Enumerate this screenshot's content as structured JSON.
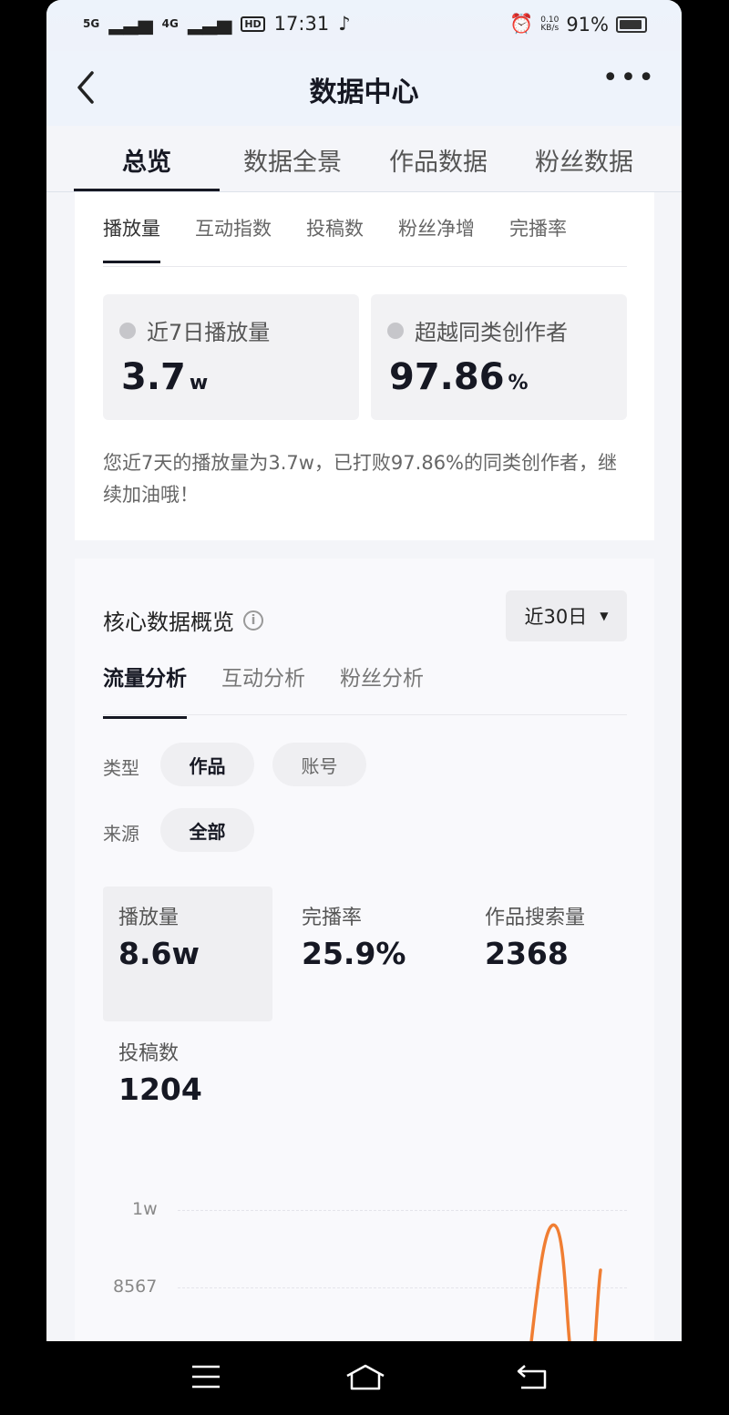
{
  "status_bar": {
    "network1": "5G",
    "network2": "4G",
    "hd": "HD",
    "time": "17:31",
    "net_speed_value": "0.10",
    "net_speed_unit": "KB/s",
    "battery": "91%"
  },
  "header": {
    "title": "数据中心"
  },
  "main_tabs": [
    {
      "label": "总览",
      "active": true
    },
    {
      "label": "数据全景",
      "active": false
    },
    {
      "label": "作品数据",
      "active": false
    },
    {
      "label": "粉丝数据",
      "active": false
    }
  ],
  "overview": {
    "subtabs": [
      {
        "label": "播放量",
        "active": true
      },
      {
        "label": "互动指数",
        "active": false
      },
      {
        "label": "投稿数",
        "active": false
      },
      {
        "label": "粉丝净增",
        "active": false
      },
      {
        "label": "完播率",
        "active": false
      }
    ],
    "stat1": {
      "label": "近7日播放量",
      "value": "3.7",
      "unit": "w"
    },
    "stat2": {
      "label": "超越同类创作者",
      "value": "97.86",
      "unit": "%"
    },
    "description": "您近7天的播放量为3.7w，已打败97.86%的同类创作者，继续加油哦！"
  },
  "core": {
    "title": "核心数据概览",
    "range": "近30日",
    "analysis_tabs": [
      {
        "label": "流量分析",
        "active": true
      },
      {
        "label": "互动分析",
        "active": false
      },
      {
        "label": "粉丝分析",
        "active": false
      }
    ],
    "type_label": "类型",
    "type_options": [
      {
        "label": "作品",
        "active": true
      },
      {
        "label": "账号",
        "active": false
      }
    ],
    "source_label": "来源",
    "source_options": [
      {
        "label": "全部",
        "active": true
      }
    ],
    "metrics": [
      {
        "label": "播放量",
        "value": "8.6w",
        "selected": true
      },
      {
        "label": "完播率",
        "value": "25.9%",
        "selected": false
      },
      {
        "label": "作品搜索量",
        "value": "2368",
        "selected": false
      },
      {
        "label": "投稿数",
        "value": "1204",
        "selected": false
      }
    ]
  },
  "chart_data": {
    "type": "line",
    "ylabels": [
      "1w",
      "8567"
    ],
    "series_color": "#f07e33"
  }
}
